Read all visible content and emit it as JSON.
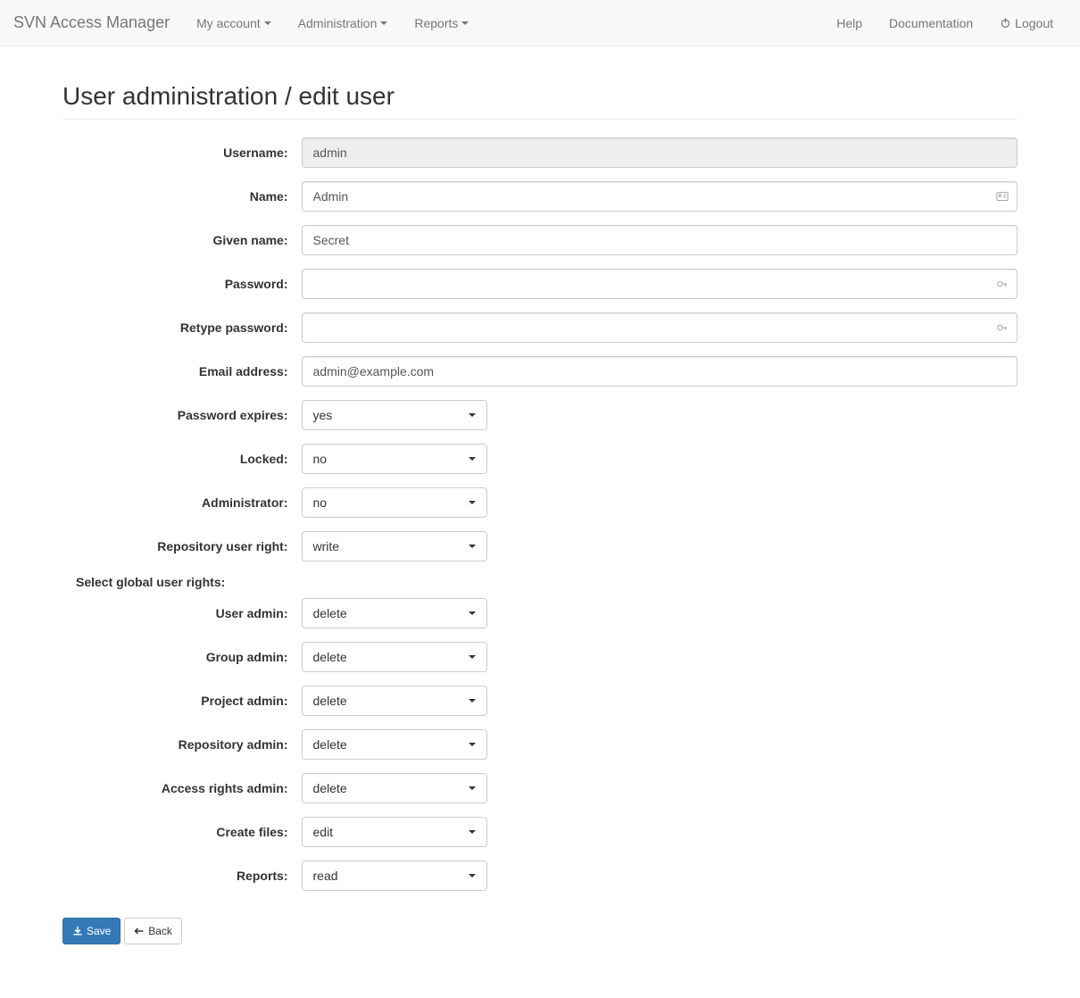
{
  "nav": {
    "brand": "SVN Access Manager",
    "left": [
      {
        "label": "My account"
      },
      {
        "label": "Administration"
      },
      {
        "label": "Reports"
      }
    ],
    "right": [
      {
        "label": "Help"
      },
      {
        "label": "Documentation"
      },
      {
        "label": "Logout",
        "icon": "power"
      }
    ]
  },
  "page": {
    "title": "User administration / edit user"
  },
  "form": {
    "username": {
      "label": "Username:",
      "value": "admin"
    },
    "name": {
      "label": "Name:",
      "value": "Admin"
    },
    "givenname": {
      "label": "Given name:",
      "value": "Secret"
    },
    "password": {
      "label": "Password:",
      "value": ""
    },
    "retype_password": {
      "label": "Retype password:",
      "value": ""
    },
    "email": {
      "label": "Email address:",
      "value": "admin@example.com"
    },
    "password_expires": {
      "label": "Password expires:",
      "value": "yes"
    },
    "locked": {
      "label": "Locked:",
      "value": "no"
    },
    "administrator": {
      "label": "Administrator:",
      "value": "no"
    },
    "repo_user_right": {
      "label": "Repository user right:",
      "value": "write"
    },
    "global_rights_section": "Select global user rights:",
    "user_admin": {
      "label": "User admin:",
      "value": "delete"
    },
    "group_admin": {
      "label": "Group admin:",
      "value": "delete"
    },
    "project_admin": {
      "label": "Project admin:",
      "value": "delete"
    },
    "repository_admin": {
      "label": "Repository admin:",
      "value": "delete"
    },
    "access_rights_admin": {
      "label": "Access rights admin:",
      "value": "delete"
    },
    "create_files": {
      "label": "Create files:",
      "value": "edit"
    },
    "reports": {
      "label": "Reports:",
      "value": "read"
    }
  },
  "buttons": {
    "save": "Save",
    "back": "Back"
  }
}
